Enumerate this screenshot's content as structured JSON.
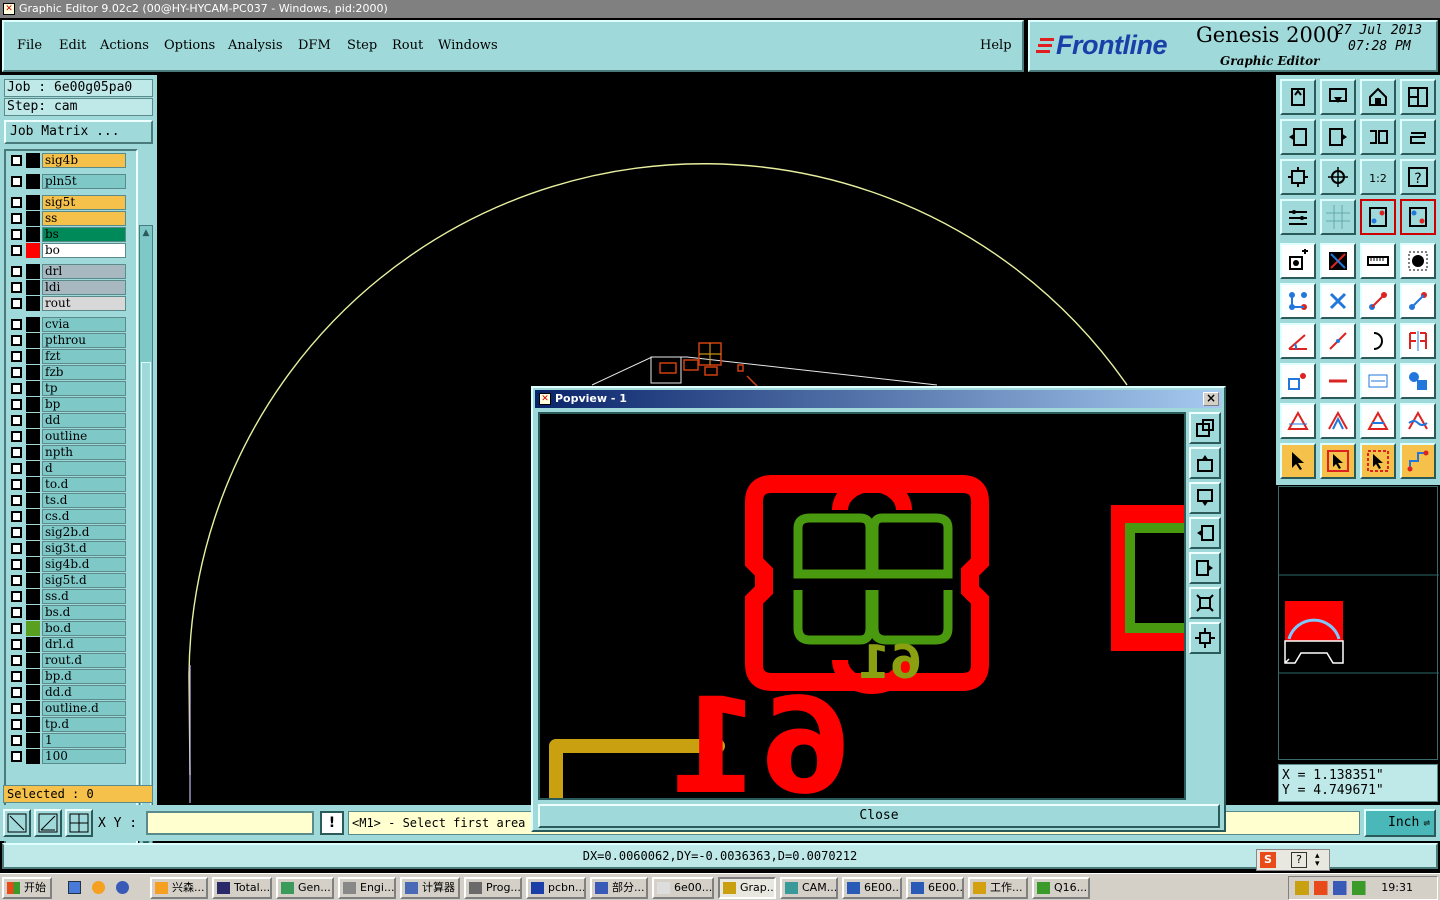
{
  "window": {
    "title": "Graphic Editor 9.02c2 (00@HY-HYCAM-PC037 - Windows, pid:2000)"
  },
  "menu": [
    {
      "label": "File"
    },
    {
      "label": "Edit"
    },
    {
      "label": "Actions"
    },
    {
      "label": "Options"
    },
    {
      "label": "Analysis"
    },
    {
      "label": "DFM"
    },
    {
      "label": "Step"
    },
    {
      "label": "Rout"
    },
    {
      "label": "Windows"
    },
    {
      "label": "Help"
    }
  ],
  "logo": {
    "brand": "Frontline",
    "product": "Genesis 2000",
    "subtitle": "Graphic Editor",
    "date": "27 Jul 2013",
    "time": "07:28 PM"
  },
  "job": {
    "job_line": "Job : 6e00g05pa0",
    "step_line": "Step: cam",
    "matrix_button": "Job Matrix ..."
  },
  "layers": [
    {
      "name": "sig4b",
      "color": "#f5c14a",
      "swatch": "#000"
    },
    {
      "name": "pln5t",
      "color": "#7fc8c8",
      "swatch": "#000"
    },
    {
      "name": "sig5t",
      "color": "#f5c14a",
      "swatch": "#000"
    },
    {
      "name": "ss",
      "color": "#f5c14a",
      "swatch": "#000"
    },
    {
      "name": "bs",
      "color": "#008a5a",
      "swatch": "#000"
    },
    {
      "name": "bo",
      "color": "#ffffff",
      "swatch": "#ff0000"
    },
    {
      "name": "drl",
      "color": "#a8b8c0",
      "swatch": "#000"
    },
    {
      "name": "ldi",
      "color": "#a8b8c0",
      "swatch": "#000"
    },
    {
      "name": "rout",
      "color": "#d8d8d8",
      "swatch": "#000"
    },
    {
      "name": "cvia",
      "color": "#7fc8c8",
      "swatch": "#000"
    },
    {
      "name": "pthrou",
      "color": "#7fc8c8",
      "swatch": "#000"
    },
    {
      "name": "fzt",
      "color": "#7fc8c8",
      "swatch": "#000"
    },
    {
      "name": "fzb",
      "color": "#7fc8c8",
      "swatch": "#000"
    },
    {
      "name": "tp",
      "color": "#7fc8c8",
      "swatch": "#000"
    },
    {
      "name": "bp",
      "color": "#7fc8c8",
      "swatch": "#000"
    },
    {
      "name": "dd",
      "color": "#7fc8c8",
      "swatch": "#000"
    },
    {
      "name": "outline",
      "color": "#7fc8c8",
      "swatch": "#000"
    },
    {
      "name": "npth",
      "color": "#7fc8c8",
      "swatch": "#000"
    },
    {
      "name": "d",
      "color": "#7fc8c8",
      "swatch": "#000"
    },
    {
      "name": "to.d",
      "color": "#7fc8c8",
      "swatch": "#000"
    },
    {
      "name": "ts.d",
      "color": "#7fc8c8",
      "swatch": "#000"
    },
    {
      "name": "cs.d",
      "color": "#7fc8c8",
      "swatch": "#000"
    },
    {
      "name": "sig2b.d",
      "color": "#7fc8c8",
      "swatch": "#000"
    },
    {
      "name": "sig3t.d",
      "color": "#7fc8c8",
      "swatch": "#000"
    },
    {
      "name": "sig4b.d",
      "color": "#7fc8c8",
      "swatch": "#000"
    },
    {
      "name": "sig5t.d",
      "color": "#7fc8c8",
      "swatch": "#000"
    },
    {
      "name": "ss.d",
      "color": "#7fc8c8",
      "swatch": "#000"
    },
    {
      "name": "bs.d",
      "color": "#7fc8c8",
      "swatch": "#000"
    },
    {
      "name": "bo.d",
      "color": "#7fc8c8",
      "swatch": "#5aa020"
    },
    {
      "name": "drl.d",
      "color": "#7fc8c8",
      "swatch": "#000"
    },
    {
      "name": "rout.d",
      "color": "#7fc8c8",
      "swatch": "#000"
    },
    {
      "name": "bp.d",
      "color": "#7fc8c8",
      "swatch": "#000"
    },
    {
      "name": "dd.d",
      "color": "#7fc8c8",
      "swatch": "#000"
    },
    {
      "name": "outline.d",
      "color": "#7fc8c8",
      "swatch": "#000"
    },
    {
      "name": "tp.d",
      "color": "#7fc8c8",
      "swatch": "#000"
    },
    {
      "name": "1",
      "color": "#7fc8c8",
      "swatch": "#000"
    },
    {
      "name": "100",
      "color": "#7fc8c8",
      "swatch": "#000"
    }
  ],
  "selected": "Selected : 0",
  "coords": {
    "x": "X = 1.138351\"",
    "y": "Y = 4.749671\""
  },
  "controls": {
    "xy_label": "X Y :",
    "xy_value": "",
    "prompt": "<M1> - Select first area corner",
    "unit": "Inch"
  },
  "status": "DX=0.0060062,DY=-0.0036363,D=0.0070212",
  "popview": {
    "title": "Popview - 1",
    "close_label": "Close",
    "silk_text": "61"
  },
  "taskbar": {
    "start": "开始",
    "items": [
      "兴森...",
      "Total...",
      "Gen...",
      "Engi...",
      "计算器",
      "Prog...",
      "pcbn...",
      "部分...",
      "6e00...",
      "Grap...",
      "CAM...",
      "6E00...",
      "6E00...",
      "工作...",
      "Q16..."
    ],
    "clock": "19:31"
  },
  "colors": {
    "panel": "#9fd9d9",
    "copper_red": "#ff0000",
    "copper_green": "#4a9a10",
    "silk": "#c8a010",
    "outline": "#e8f0a0"
  }
}
